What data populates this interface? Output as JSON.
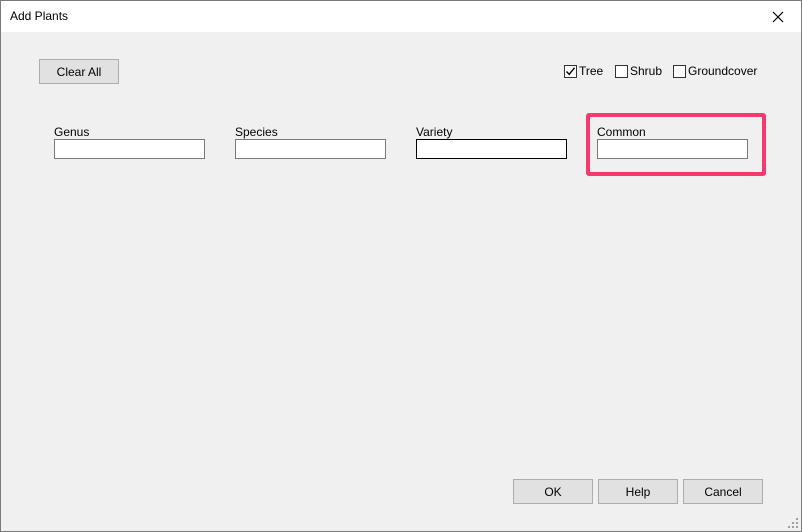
{
  "window": {
    "title": "Add Plants",
    "close_icon": "close-icon"
  },
  "toolbar": {
    "clear_all_label": "Clear All"
  },
  "filters": [
    {
      "label": "Tree",
      "checked": true
    },
    {
      "label": "Shrub",
      "checked": false
    },
    {
      "label": "Groundcover",
      "checked": false
    }
  ],
  "fields": {
    "genus": {
      "label": "Genus",
      "value": ""
    },
    "species": {
      "label": "Species",
      "value": ""
    },
    "variety": {
      "label": "Variety",
      "value": ""
    },
    "common": {
      "label": "Common",
      "value": ""
    }
  },
  "actions": {
    "ok_label": "OK",
    "help_label": "Help",
    "cancel_label": "Cancel"
  },
  "colors": {
    "highlight": "#f7396e",
    "dialog_bg": "#f0f0f0",
    "button_bg": "#e1e1e1"
  }
}
